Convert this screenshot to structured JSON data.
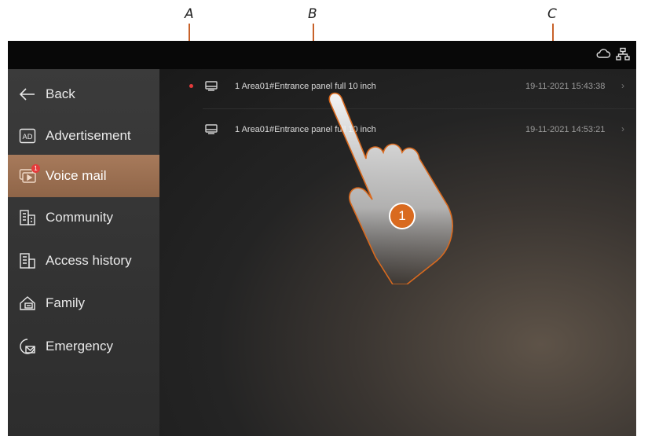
{
  "annotations": {
    "a": "A",
    "b": "B",
    "c": "C",
    "step": "1"
  },
  "status": {
    "cloud_icon": "cloud-icon",
    "network_icon": "network-icon"
  },
  "sidebar": {
    "items": [
      {
        "label": "Back",
        "icon": "arrow-left-icon"
      },
      {
        "label": "Advertisement",
        "icon": "ad-icon"
      },
      {
        "label": "Voice mail",
        "icon": "voicemail-icon",
        "active": true,
        "badge": "1"
      },
      {
        "label": "Community",
        "icon": "community-icon"
      },
      {
        "label": "Access history",
        "icon": "access-history-icon"
      },
      {
        "label": "Family",
        "icon": "family-icon"
      },
      {
        "label": "Emergency",
        "icon": "emergency-icon"
      }
    ]
  },
  "messages": [
    {
      "title": "1 Area01#Entrance panel full 10 inch",
      "date": "19-11-2021 15:43:38",
      "unread": true,
      "chevron": "›"
    },
    {
      "title": "1 Area01#Entrance panel full 10 inch",
      "date": "19-11-2021 14:53:21",
      "unread": false,
      "chevron": "›"
    }
  ],
  "colors": {
    "accent": "#a77a5b",
    "unread_dot": "#e53b3b",
    "callout": "#d96a1f"
  }
}
